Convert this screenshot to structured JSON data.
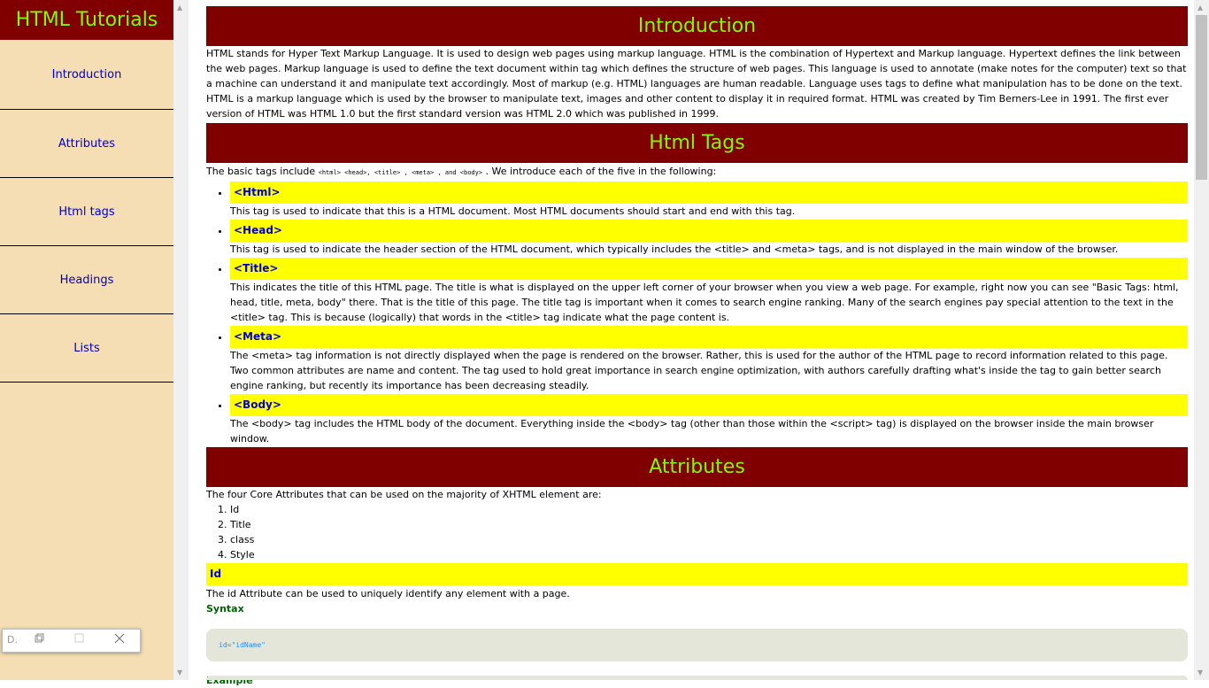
{
  "sidebar": {
    "title": "HTML Tutorials",
    "items": [
      {
        "label": "Introduction"
      },
      {
        "label": "Attributes"
      },
      {
        "label": "Html tags"
      },
      {
        "label": "Headings"
      },
      {
        "label": "Lists"
      }
    ]
  },
  "mini_window": {
    "label": "D."
  },
  "intro": {
    "title": "Introduction",
    "p1": "HTML stands for Hyper Text Markup Language. It is used to design web pages using markup language. HTML is the combination of Hypertext and Markup language. Hypertext defines the link between the web pages. Markup language is used to define the text document within tag which defines the structure of web pages. This language is used to annotate (make notes for the computer) text so that a machine can understand it and manipulate text accordingly. Most of markup (e.g. HTML) languages are human readable. Language uses tags to define what manipulation has to be done on the text.",
    "p2": "HTML is a markup language which is used by the browser to manipulate text, images and other content to display it in required format. HTML was created by Tim Berners-Lee in 1991. The first ever version of HTML was HTML 1.0 but the first standard version was HTML 2.0 which was published in 1999."
  },
  "tags": {
    "title": "Html Tags",
    "intro_prefix": "The basic tags include ",
    "intro_code": "<html> <head>, <title> , <meta> , and <body>",
    "intro_suffix": " . We introduce each of the five in the following:",
    "items": [
      {
        "head": "<Html>",
        "desc": "This tag is used to indicate that this is a HTML document. Most HTML documents should start and end with this tag."
      },
      {
        "head": "<Head>",
        "desc": "This tag is used to indicate the header section of the HTML document, which typically includes the <title> and <meta> tags, and is not displayed in the main window of the browser."
      },
      {
        "head": "<Title>",
        "desc": "This indicates the title of this HTML page. The title is what is displayed on the upper left corner of your browser when you view a web page. For example, right now you can see \"Basic Tags: html, head, title, meta, body\" there. That is the title of this page. The title tag is important when it comes to search engine ranking. Many of the search engines pay special attention to the text in the <title> tag. This is because (logically) that words in the <title> tag indicate what the page content is."
      },
      {
        "head": "<Meta>",
        "desc": "The <meta> tag information is not directly displayed when the page is rendered on the browser. Rather, this is used for the author of the HTML page to record information related to this page. Two common attributes are name and content. The tag used to hold great importance in search engine optimization, with authors carefully drafting what's inside the tag to gain better search engine ranking, but recently its importance has been decreasing steadily."
      },
      {
        "head": "<Body>",
        "desc": "The <body> tag includes the HTML body of the document. Everything inside the <body> tag (other than those within the <script> tag) is displayed on the browser inside the main browser window."
      }
    ]
  },
  "attributes": {
    "title": "Attributes",
    "intro": "The four Core Attributes that can be used on the majority of XHTML element are:",
    "list": [
      "Id",
      "Title",
      "class",
      "Style"
    ],
    "id_head": "Id",
    "id_desc": "The id Attribute can be used to uniquely identify any element with a page.",
    "syntax_label": "Syntax",
    "syntax_code": "id=\"idName\"",
    "example_label": "Example"
  },
  "colors": {
    "header_bg": "#800000",
    "header_text": "#7cfc00",
    "highlight": "#ffff00",
    "link": "#0000cd",
    "sidebar_bg": "#f5deb3"
  }
}
